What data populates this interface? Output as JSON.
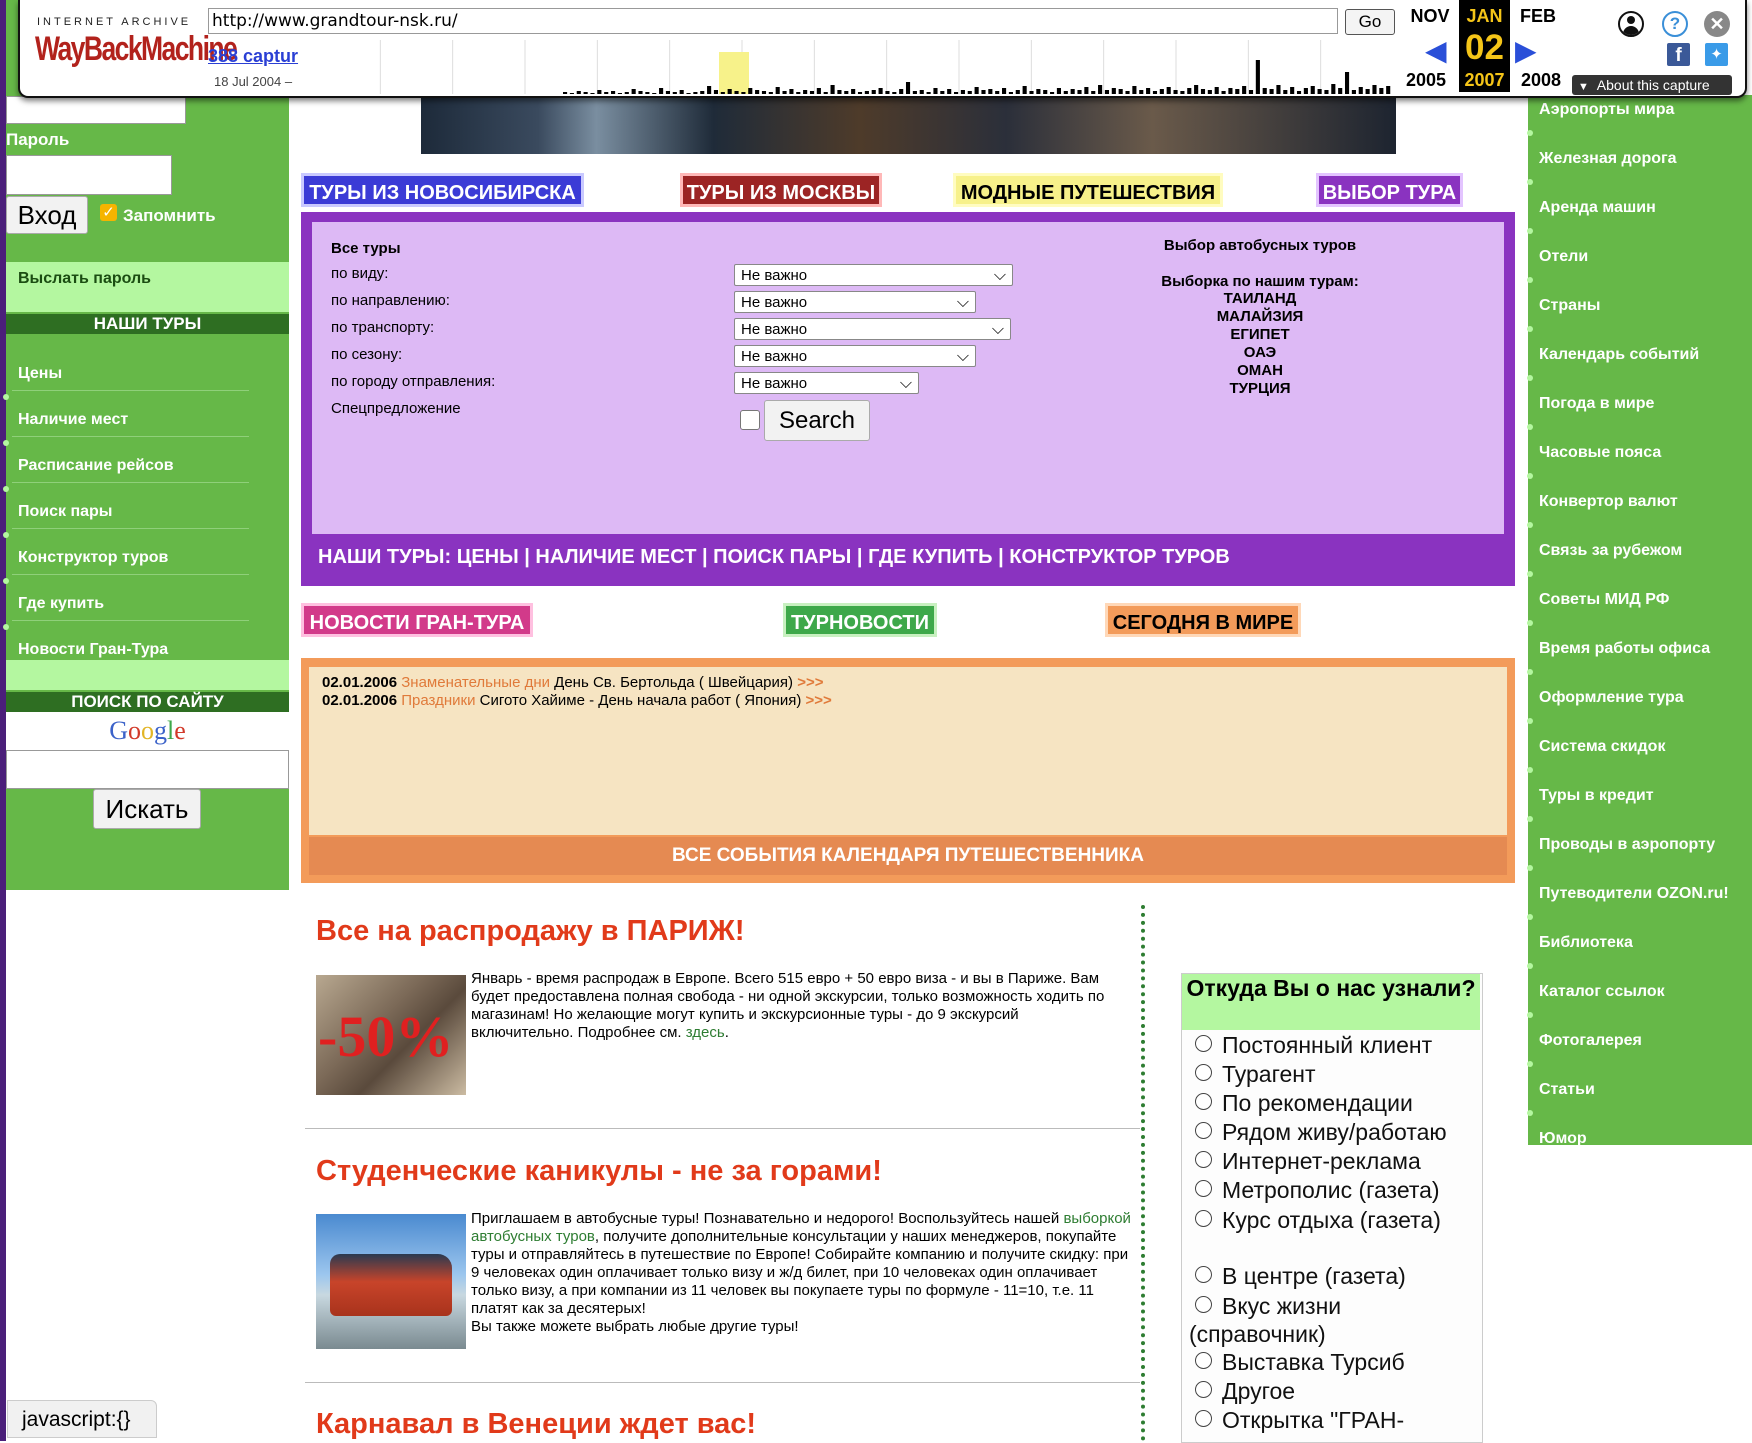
{
  "wayback": {
    "brand_top": "INTERNET ARCHIVE",
    "brand_logo": "WayBackMachine",
    "url": "http://www.grandtour-nsk.ru/",
    "go_label": "Go",
    "captures_link": "388 captur",
    "captures_date": "18 Jul 2004 –",
    "months": {
      "prev": "NOV",
      "current": "JAN",
      "next": "FEB"
    },
    "day": "02",
    "years": {
      "prev": "2005",
      "current": "2007",
      "next": "2008"
    },
    "about_label": "About this capture",
    "histogram_heights": [
      2,
      1,
      3,
      2,
      1,
      4,
      2,
      3,
      1,
      2,
      5,
      3,
      2,
      1,
      6,
      3,
      2,
      4,
      1,
      2,
      3,
      8,
      4,
      2,
      5,
      3,
      2,
      6,
      4,
      3,
      2,
      7,
      3,
      5,
      2,
      4,
      3,
      6,
      2,
      9,
      4,
      3,
      5,
      2,
      3,
      4,
      6,
      3,
      2,
      5,
      12,
      3,
      4,
      2,
      6,
      3,
      5,
      2,
      4,
      3,
      7,
      4,
      5,
      3,
      6,
      2,
      4,
      8,
      3,
      5,
      4,
      2,
      6,
      3,
      5,
      4,
      7,
      3,
      9,
      4,
      6,
      5,
      3,
      8,
      4,
      6,
      3,
      5,
      7,
      4,
      3,
      6,
      9,
      5,
      4,
      7,
      3,
      6,
      5,
      8,
      4,
      34,
      6,
      5,
      9,
      4,
      7,
      3,
      6,
      8,
      5,
      4,
      10,
      6,
      22,
      4,
      7,
      5,
      9,
      6,
      8
    ]
  },
  "left": {
    "password_label": "Пароль",
    "login_button": "Вход",
    "remember_label": "Запомнить",
    "send_password": "Выслать пароль",
    "our_tours_header": "НАШИ ТУРЫ",
    "links": [
      "Цены",
      "Наличие мест",
      "Расписание рейсов",
      "Поиск пары",
      "Конструктор туров",
      "Где купить",
      "Новости Гран-Тура"
    ],
    "site_search_header": "ПОИСК ПО САЙТУ",
    "google_logo": "Google",
    "search_button": "Искать"
  },
  "tabs": [
    {
      "label": "ТУРЫ ИЗ НОВОСИБИРСКА",
      "bg": "#3b3bd6",
      "color": "#ffffff"
    },
    {
      "label": "ТУРЫ ИЗ МОСКВЫ",
      "bg": "#9c2424",
      "color": "#ffffff"
    },
    {
      "label": "МОДНЫЕ ПУТЕШЕСТВИЯ",
      "bg": "#f7f18a",
      "color": "#000000"
    },
    {
      "label": "ВЫБОР ТУРА",
      "bg": "#8a33c0",
      "color": "#ffffff"
    }
  ],
  "filter": {
    "title": "Все туры",
    "rows": [
      {
        "label": "по виду:",
        "value": "Не важно"
      },
      {
        "label": "по направлению:",
        "value": "Не важно"
      },
      {
        "label": "по транспорту:",
        "value": "Не важно"
      },
      {
        "label": "по сезону:",
        "value": "Не важно"
      },
      {
        "label": "по городу отправления:",
        "value": "Не важно"
      }
    ],
    "special_label": "Спецпредложение",
    "search_button": "Search",
    "bus_title": "Выбор автобусных туров",
    "selection_title": "Выборка по нашим турам:",
    "destinations": [
      "ТАИЛАНД",
      "МАЛАЙЗИЯ",
      "ЕГИПЕТ",
      "ОАЭ",
      "ОМАН",
      "ТУРЦИЯ"
    ],
    "bottom_bar": "НАШИ ТУРЫ: ЦЕНЫ | НАЛИЧИЕ МЕСТ | ПОИСК ПАРЫ | ГДЕ КУПИТЬ | КОНСТРУКТОР ТУРОВ"
  },
  "news_tabs": [
    {
      "label": "НОВОСТИ ГРАН-ТУРА",
      "bg": "#d23a8a"
    },
    {
      "label": "ТУРНОВОСТИ",
      "bg": "#3ea84a"
    },
    {
      "label": "СЕГОДНЯ В МИРЕ",
      "bg": "#f39b5a"
    }
  ],
  "calendar": {
    "items": [
      {
        "date": "02.01.2006",
        "category": "Знаменательные дни",
        "text": "День Св. Бертольда  ( Швейцария)",
        "more": ">>>"
      },
      {
        "date": "02.01.2006",
        "category": "Праздники",
        "text": "Сигото Хайиме - День начала работ  ( Япония)",
        "more": ">>>"
      }
    ],
    "all_events": "ВСЕ СОБЫТИЯ КАЛЕНДАРЯ ПУТЕШЕСТВЕННИКА"
  },
  "articles": [
    {
      "title": "Все на распродажу в ПАРИЖ!",
      "image_text": "-50%",
      "body": "Январь - время распродаж в Европе. Всего 515 евро + 50 евро виза - и вы в Париже. Вам будет предоставлена полная свобода - ни одной экскурсии, только возможность ходить по магазинам! Но желающие могут купить и экскурсионные туры - до 9 экскурсий включительно. Подробнее см. ",
      "link": "здесь",
      "tail": "."
    },
    {
      "title": "Студенческие каникулы - не за горами!",
      "body_start": "Приглашаем в автобусные туры! Познавательно и недорого! Воспользуйтесь нашей ",
      "link": "выборкой автобусных туров",
      "body_end": ", получите дополнительные консультации у наших менеджеров, покупайте туры и отправляйтесь в путешествие по Европе! Собирайте компанию и получите скидку: при 9 человеках один оплачивает только визу и ж/д билет, при 10 человеках один оплачивает только визу, а при компании из 11 человек вы покупаете туры по формуле - 11=10, т.е. 11 платят как за десятерых!",
      "body_last": "Вы также можете выбрать любые другие туры!"
    },
    {
      "title": "Карнавал в Венеции ждет вас!"
    }
  ],
  "survey": {
    "title": "Откуда Вы о нас узнали?",
    "options": [
      "Постоянный клиент",
      "Турагент",
      "По рекомендации",
      "Рядом живу/работаю",
      "Интернет-реклама",
      "Метрополис (газета)",
      "Курс отдыха (газета)",
      "В центре (газета)",
      "Вкус жизни (справочник)",
      "Выставка Турсиб",
      "Другое",
      "Открытка \"ГРАН-"
    ]
  },
  "right": {
    "links": [
      "Аэропорты мира",
      "Железная дорога",
      "Аренда машин",
      "Отели",
      "Страны",
      "Календарь событий",
      "Погода в мире",
      "Часовые пояса",
      "Конвертор валют",
      "Связь за рубежом",
      "Советы МИД РФ",
      "Время работы офиса",
      "Оформление тура",
      "Система скидок",
      "Туры в кредит",
      "Проводы в аэропорту",
      "Путеводители OZON.ru!",
      "Библиотека",
      "Каталог ссылок",
      "Фотогалерея",
      "Статьи",
      "Юмор"
    ]
  },
  "status_bar": "javascript:{}",
  "colors": {
    "green": "#66b848",
    "light_green": "#b4f7a0",
    "purple": "#8a33c0",
    "lilac": "#ddb9f5",
    "orange": "#f39b5a",
    "article_red": "#e13a1a"
  }
}
